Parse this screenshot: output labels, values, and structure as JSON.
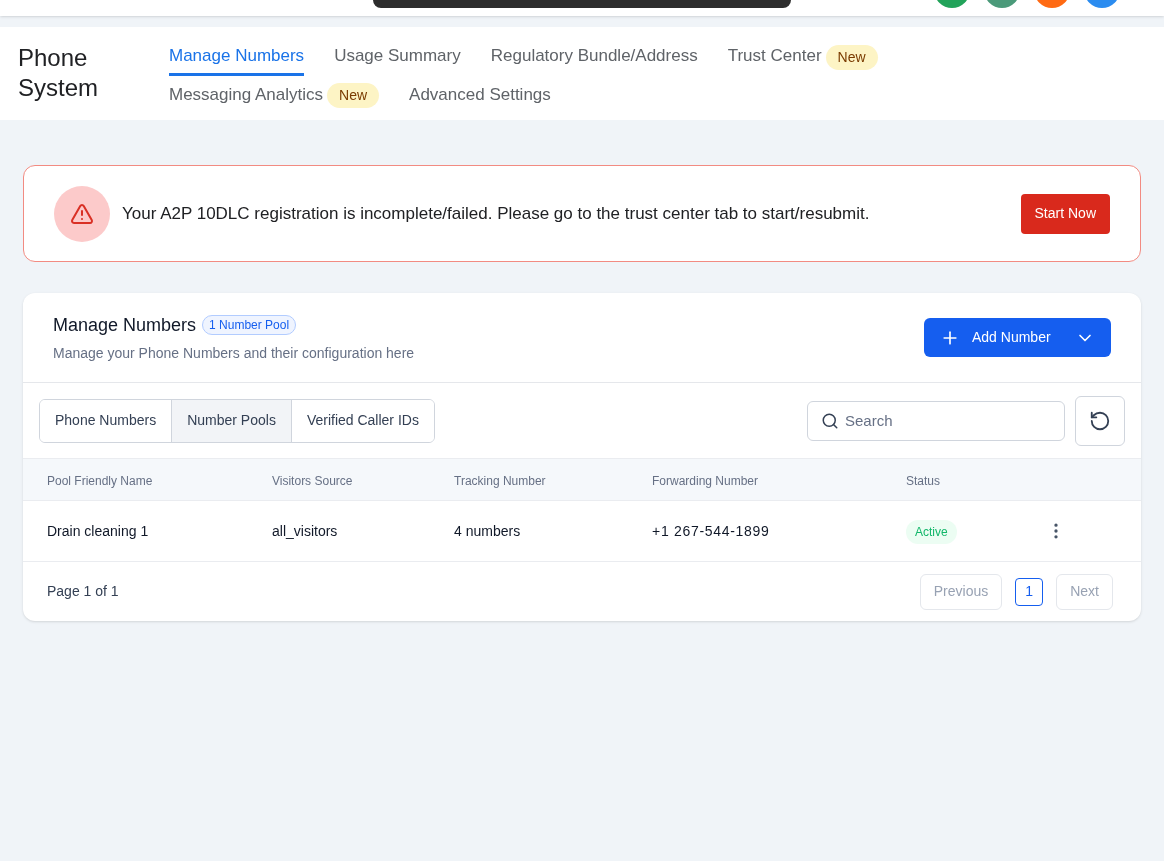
{
  "top_bar": {
    "avatars": [
      {
        "color": "#22a35a"
      },
      {
        "color": "#4b9a7a"
      },
      {
        "color": "#ff6a13"
      },
      {
        "color": "#2b8cf0"
      }
    ]
  },
  "header": {
    "title": "Phone System",
    "tabs": [
      {
        "label": "Manage Numbers",
        "selected": true
      },
      {
        "label": "Usage Summary",
        "selected": false
      },
      {
        "label": "Regulatory Bundle/Address",
        "selected": false
      },
      {
        "label": "Trust Center",
        "selected": false,
        "badge": "New"
      },
      {
        "label": "Messaging Analytics",
        "selected": false,
        "badge": "New"
      },
      {
        "label": "Advanced Settings",
        "selected": false
      }
    ]
  },
  "alert": {
    "message": "Your A2P 10DLC registration is incomplete/failed. Please go to the trust center tab to start/resubmit.",
    "button": "Start Now"
  },
  "card": {
    "title": "Manage Numbers",
    "badge": "1 Number Pool",
    "subtitle": "Manage your Phone Numbers and their configuration here",
    "add_button": "Add Number",
    "segments": [
      {
        "label": "Phone Numbers",
        "selected": false
      },
      {
        "label": "Number Pools",
        "selected": true
      },
      {
        "label": "Verified Caller IDs",
        "selected": false
      }
    ],
    "search": {
      "placeholder": "Search"
    },
    "table": {
      "columns": [
        "Pool Friendly Name",
        "Visitors Source",
        "Tracking Number",
        "Forwarding Number",
        "Status"
      ],
      "rows": [
        {
          "cells": [
            "Drain cleaning 1",
            "all_visitors",
            "4 numbers",
            "+1 267-544-1899"
          ],
          "status": "Active"
        }
      ]
    },
    "pagination": {
      "summary": "Page 1 of 1",
      "previous": "Previous",
      "pages": [
        {
          "label": "1",
          "selected": true
        }
      ],
      "next": "Next"
    }
  }
}
